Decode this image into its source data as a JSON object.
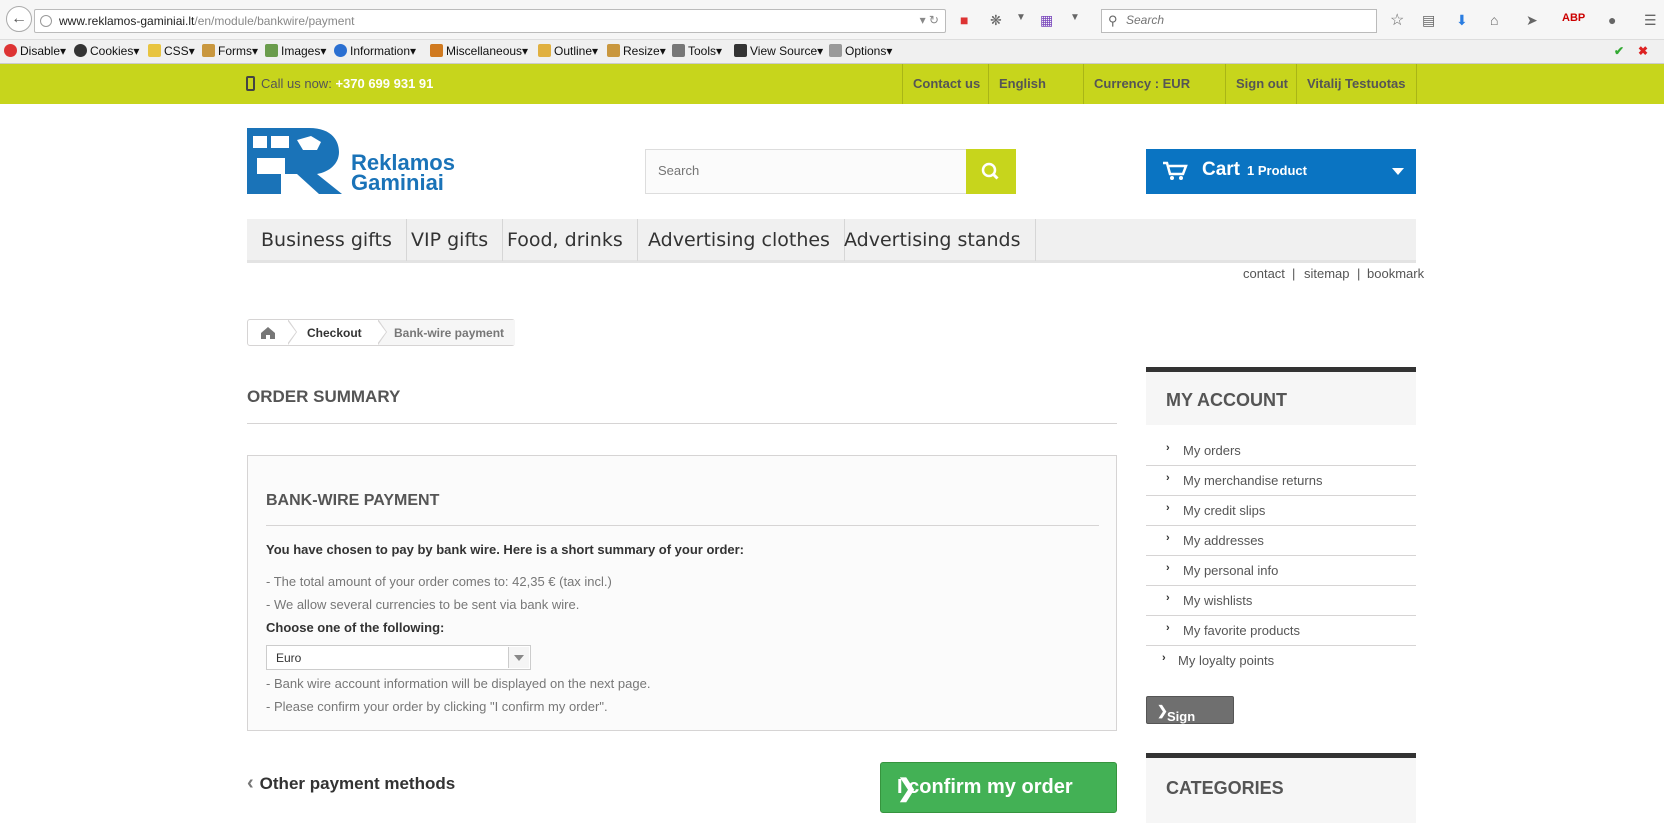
{
  "browser": {
    "url_domain": "www.reklamos-gaminiai.lt",
    "url_path": "/en/module/bankwire/payment",
    "search_placeholder": "Search"
  },
  "dev_toolbar": {
    "items": [
      "Disable",
      "Cookies",
      "CSS",
      "Forms",
      "Images",
      "Information",
      "Miscellaneous",
      "Outline",
      "Resize",
      "Tools",
      "View Source",
      "Options"
    ]
  },
  "topbar": {
    "callus_label": "Call us now:",
    "phone": "+370 699 931 91",
    "contact": "Contact us",
    "language": "English",
    "currency": "Currency : EUR",
    "signout": "Sign out",
    "user": "Vitalij Testuotas"
  },
  "header": {
    "logo_line1": "Reklamos",
    "logo_line2": "Gaminiai",
    "search_placeholder": "Search",
    "cart_label": "Cart",
    "cart_qty": "1 Product"
  },
  "menu": {
    "items": [
      "Business gifts",
      "VIP gifts",
      "Food, drinks",
      "Advertising clothes",
      "Advertising stands"
    ]
  },
  "utility": {
    "contact": "contact",
    "sitemap": "sitemap",
    "bookmark": "bookmark"
  },
  "breadcrumb": {
    "item1": "Checkout",
    "item2": "Bank-wire payment"
  },
  "main": {
    "heading": "ORDER SUMMARY",
    "box_title": "BANK-WIRE PAYMENT",
    "intro": "You have chosen to pay by bank wire. Here is a short summary of your order:",
    "total_line": "- The total amount of your order comes to: 42,35 € (tax incl.)",
    "currencies_line": "- We allow several currencies to be sent via bank wire.",
    "choose_label": "Choose one of the following:",
    "currency_selected": "Euro",
    "info_line": "- Bank wire account information will be displayed on the next page.",
    "confirm_line": "- Please confirm your order by clicking \"I confirm my order\".",
    "other_methods": "Other payment methods",
    "confirm_button": "I confirm my order"
  },
  "sidebar": {
    "account_title": "MY ACCOUNT",
    "items": [
      "My orders",
      "My merchandise returns",
      "My credit slips",
      "My addresses",
      "My personal info",
      "My wishlists",
      "My favorite products",
      "My loyalty points"
    ],
    "signout_button": "Sign out",
    "categories_title": "CATEGORIES"
  },
  "colors": {
    "accent": "#c7d51c",
    "cart_blue": "#0a74c2",
    "confirm_green": "#43b155"
  }
}
